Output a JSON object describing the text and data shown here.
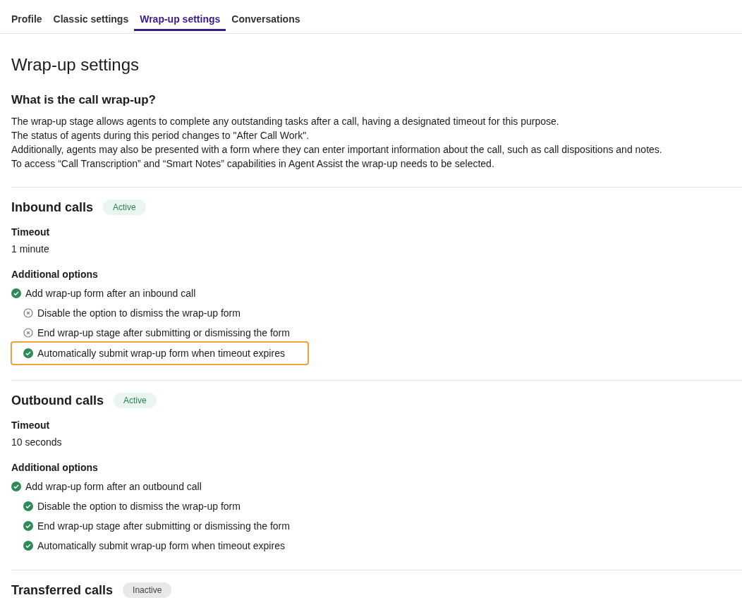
{
  "tabs": [
    {
      "label": "Profile",
      "selected": false
    },
    {
      "label": "Classic settings",
      "selected": false
    },
    {
      "label": "Wrap-up settings",
      "selected": true
    },
    {
      "label": "Conversations",
      "selected": false
    }
  ],
  "page_title": "Wrap-up settings",
  "intro": {
    "heading": "What is the call wrap-up?",
    "lines": [
      "The wrap-up stage allows agents to complete any outstanding tasks after a call, having a designated timeout for this purpose.",
      "The status of agents during this period changes to \"After Call Work\".",
      "Additionally, agents may also be presented with a form where they can enter important information about the call, such as call dispositions and notes.",
      "To access “Call Transcription” and “Smart Notes” capabilities in Agent Assist the wrap-up needs to be selected."
    ]
  },
  "sections": [
    {
      "title": "Inbound calls",
      "status": "Active",
      "active": true,
      "timeout_label": "Timeout",
      "timeout": "1 minute",
      "options_label": "Additional options",
      "options": [
        {
          "label": "Add wrap-up form after an inbound call",
          "enabled": true,
          "highlighted": false,
          "children": [
            {
              "label": "Disable the option to dismiss the wrap-up form",
              "enabled": false,
              "highlighted": false
            },
            {
              "label": "End wrap-up stage after submitting or dismissing the form",
              "enabled": false,
              "highlighted": false
            },
            {
              "label": "Automatically submit wrap-up form when timeout expires",
              "enabled": true,
              "highlighted": true
            }
          ]
        }
      ]
    },
    {
      "title": "Outbound calls",
      "status": "Active",
      "active": true,
      "timeout_label": "Timeout",
      "timeout": "10 seconds",
      "options_label": "Additional options",
      "options": [
        {
          "label": "Add wrap-up form after an outbound call",
          "enabled": true,
          "highlighted": false,
          "children": [
            {
              "label": "Disable the option to dismiss the wrap-up form",
              "enabled": true,
              "highlighted": false
            },
            {
              "label": "End wrap-up stage after submitting or dismissing the form",
              "enabled": true,
              "highlighted": false
            },
            {
              "label": "Automatically submit wrap-up form when timeout expires",
              "enabled": true,
              "highlighted": false
            }
          ]
        }
      ]
    },
    {
      "title": "Transferred calls",
      "status": "Inactive",
      "active": false
    }
  ]
}
